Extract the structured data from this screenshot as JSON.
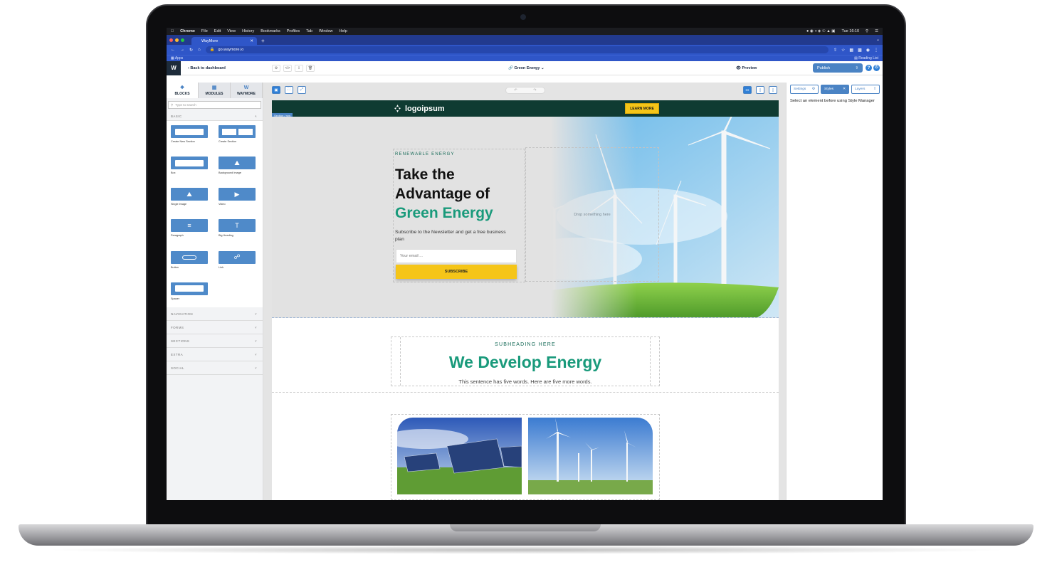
{
  "mac_menubar": {
    "items": [
      "Chrome",
      "File",
      "Edit",
      "View",
      "History",
      "Bookmarks",
      "Profiles",
      "Tab",
      "Window",
      "Help"
    ],
    "clock": "Tue 16:10"
  },
  "browser": {
    "tab_title": "WayMore",
    "url": "go.waymore.io",
    "apps_label": "Apps",
    "reading_list": "Reading List"
  },
  "editor": {
    "back_label": "Back to dashboard",
    "page_name": "Green Energy",
    "preview_label": "Preview",
    "publish_label": "Publish"
  },
  "left_panel": {
    "tabs": [
      "BLOCKS",
      "MODULES",
      "WAYMORE"
    ],
    "search_placeholder": "Type to search",
    "basic_label": "BASIC",
    "blocks": [
      {
        "label": "Create New Section",
        "icon": "section"
      },
      {
        "label": "Create Section",
        "icon": "split"
      },
      {
        "label": "Box",
        "icon": "box"
      },
      {
        "label": "Background Image",
        "icon": "image"
      },
      {
        "label": "Single Image",
        "icon": "image"
      },
      {
        "label": "Video",
        "icon": "video"
      },
      {
        "label": "Paragraph",
        "icon": "paragraph"
      },
      {
        "label": "Big Heading",
        "icon": "heading"
      },
      {
        "label": "Button",
        "icon": "button"
      },
      {
        "label": "Link",
        "icon": "link"
      },
      {
        "label": "Spacer",
        "icon": "box"
      }
    ],
    "categories": [
      "NAVIGATION",
      "FORMS",
      "SECTIONS",
      "EXTRA",
      "SOCIAL"
    ]
  },
  "canvas": {
    "selection_tag": "Section / row",
    "header": {
      "logo_text": "logoipsum",
      "cta_label": "LEARN MORE"
    },
    "hero": {
      "subheading": "RENEWABLE ENERGY",
      "title_line1": "Take the",
      "title_line2": "Advantage of",
      "title_green": "Green Energy",
      "description": "Subscribe to the Newsletter and get a free business plan",
      "email_placeholder": "Your email ...",
      "subscribe_label": "SUBSCRIBE",
      "dropzone_text": "Drop something here"
    },
    "section2": {
      "subheading": "SUBHEADING HERE",
      "title": "We Develop Energy",
      "text": "This sentence has five words. Here are five more words."
    }
  },
  "right_panel": {
    "tabs": [
      "Settings",
      "Styles",
      "Layers"
    ],
    "message": "Select an element before using Style Manager"
  },
  "colors": {
    "brand_green": "#199a7b",
    "header_dark": "#0f3b32",
    "cta_yellow": "#f5c518",
    "editor_blue": "#4a83c4",
    "chrome_blue": "#2f56c8"
  }
}
